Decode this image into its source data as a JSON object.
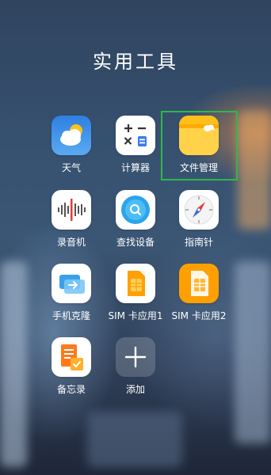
{
  "folder": {
    "title": "实用工具"
  },
  "apps": [
    {
      "label": "天气",
      "icon": "weather-icon"
    },
    {
      "label": "计算器",
      "icon": "calculator-icon"
    },
    {
      "label": "文件管理",
      "icon": "file-manager-icon",
      "highlighted": true
    },
    {
      "label": "录音机",
      "icon": "recorder-icon"
    },
    {
      "label": "查找设备",
      "icon": "find-device-icon"
    },
    {
      "label": "指南针",
      "icon": "compass-icon"
    },
    {
      "label": "手机克隆",
      "icon": "phone-clone-icon"
    },
    {
      "label": "SIM 卡应用1",
      "icon": "sim-card-icon"
    },
    {
      "label": "SIM 卡应用2",
      "icon": "sim-card-icon"
    },
    {
      "label": "备忘录",
      "icon": "notepad-icon"
    },
    {
      "label": "添加",
      "icon": "plus-icon"
    }
  ],
  "colors": {
    "highlight_frame": "#2fb84a",
    "weather": "#3a8ee6",
    "files": "#ffb400",
    "sim": "#ffa000",
    "notepad": "#ff8a1f"
  }
}
